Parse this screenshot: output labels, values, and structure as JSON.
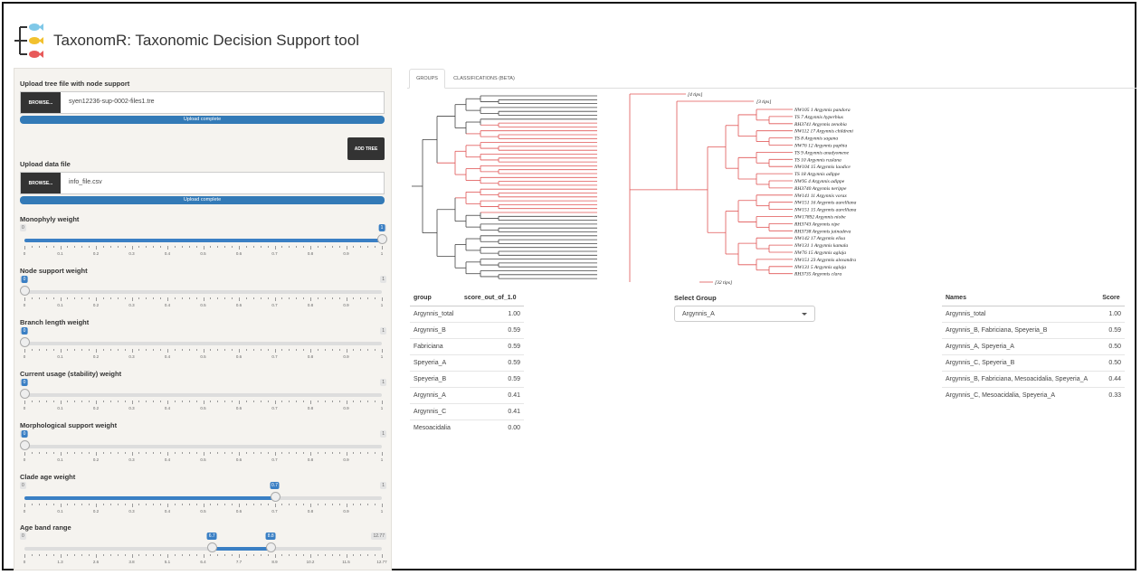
{
  "app": {
    "title": "TaxonomR: Taxonomic Decision Support tool"
  },
  "sidebar": {
    "tree_upload": {
      "label": "Upload tree file with node support",
      "browse_label": "BROWSE...",
      "filename": "syen12236-sup-0002-files1.tre",
      "status": "Upload complete"
    },
    "add_tree_label": "ADD TREE",
    "data_upload": {
      "label": "Upload data file",
      "browse_label": "BROWSE...",
      "filename": "info_file.csv",
      "status": "Upload complete"
    },
    "sliders": [
      {
        "label": "Monophyly weight",
        "value": 1,
        "value_label": "1",
        "min_label": "0",
        "max_label": "1",
        "ticks": [
          "0",
          "0.1",
          "0.2",
          "0.3",
          "0.4",
          "0.5",
          "0.6",
          "0.7",
          "0.8",
          "0.9",
          "1"
        ]
      },
      {
        "label": "Node support weight",
        "value": 0,
        "value_label": "0",
        "min_label": "0",
        "max_label": "1",
        "ticks": [
          "0",
          "0.1",
          "0.2",
          "0.3",
          "0.4",
          "0.5",
          "0.6",
          "0.7",
          "0.8",
          "0.9",
          "1"
        ]
      },
      {
        "label": "Branch length weight",
        "value": 0,
        "value_label": "0",
        "min_label": "0",
        "max_label": "1",
        "ticks": [
          "0",
          "0.1",
          "0.2",
          "0.3",
          "0.4",
          "0.5",
          "0.6",
          "0.7",
          "0.8",
          "0.9",
          "1"
        ]
      },
      {
        "label": "Current usage (stability) weight",
        "value": 0,
        "value_label": "0",
        "min_label": "0",
        "max_label": "1",
        "ticks": [
          "0",
          "0.1",
          "0.2",
          "0.3",
          "0.4",
          "0.5",
          "0.6",
          "0.7",
          "0.8",
          "0.9",
          "1"
        ]
      },
      {
        "label": "Morphological support weight",
        "value": 0,
        "value_label": "0",
        "min_label": "0",
        "max_label": "1",
        "ticks": [
          "0",
          "0.1",
          "0.2",
          "0.3",
          "0.4",
          "0.5",
          "0.6",
          "0.7",
          "0.8",
          "0.9",
          "1"
        ]
      },
      {
        "label": "Clade age weight",
        "value": 0.7,
        "value_label": "0.7",
        "min_label": "0",
        "max_label": "1",
        "ticks": [
          "0",
          "0.1",
          "0.2",
          "0.3",
          "0.4",
          "0.5",
          "0.6",
          "0.7",
          "0.8",
          "0.9",
          "1"
        ]
      }
    ],
    "age_band": {
      "label": "Age band range",
      "low": 6.7,
      "high": 8.8,
      "low_label": "6.7",
      "high_label": "8.8",
      "min": 0,
      "max": 12.77,
      "min_label": "0",
      "max_label": "12.77",
      "ticks": [
        "0",
        "1.3",
        "2.6",
        "3.8",
        "5.1",
        "6.4",
        "7.7",
        "8.9",
        "10.2",
        "11.5",
        "12.77"
      ]
    }
  },
  "tabs": [
    {
      "label": "GROUPS",
      "active": true
    },
    {
      "label": "CLASSIFICATIONS (BETA)",
      "active": false
    }
  ],
  "tree_collapsed_labels": [
    "[4 tips]",
    "[3 tips]",
    "[32 tips]"
  ],
  "tips": [
    "NW105 1 Argynnis pandora",
    "TS 7 Argynnis hyperbius",
    "RH3741 Argynnis zenobia",
    "NW112 17 Argynnis childreni",
    "TS 8 Argynnis sagana",
    "NW76 12 Argynnis paphia",
    "TS 9 Argynnis anadyomene",
    "TS 10 Argynnis ruslana",
    "NW104 15 Argynnis laodice",
    "TS 18 Argynnis adippe",
    "NW95 4 Argynnis adippe",
    "RH3740 Argynnis nerippe",
    "NW141 11 Argynnis vorax",
    "NW151 16 Argynnis aurelliana",
    "NW151 15 Argynnis aurelliana",
    "NW17892 Argynnis niobe",
    "RH3743 Argynnis xipe",
    "RH3738 Argynnis jainadeva",
    "NW142 17 Argynnis elisa",
    "NW131 1 Argynnis kamala",
    "NW76 15 Argynnis aglaja",
    "NW151 23 Argynnis alexandra",
    "NW131 5 Argynnis aglaja",
    "RH3735 Argynnis clara"
  ],
  "group_table": {
    "headers": [
      "group",
      "score_out_of_1.0"
    ],
    "rows": [
      [
        "Argynnis_total",
        "1.00"
      ],
      [
        "Argynnis_B",
        "0.59"
      ],
      [
        "Fabriciana",
        "0.59"
      ],
      [
        "Speyeria_A",
        "0.59"
      ],
      [
        "Speyeria_B",
        "0.59"
      ],
      [
        "Argynnis_A",
        "0.41"
      ],
      [
        "Argynnis_C",
        "0.41"
      ],
      [
        "Mesoacidalia",
        "0.00"
      ]
    ]
  },
  "select_group": {
    "label": "Select Group",
    "value": "Argynnis_A"
  },
  "score_table": {
    "headers": [
      "Names",
      "Score"
    ],
    "rows": [
      [
        "Argynnis_total",
        "1.00"
      ],
      [
        "Argynnis_B, Fabriciana, Speyeria_B",
        "0.59"
      ],
      [
        "Argynnis_A, Speyeria_A",
        "0.50"
      ],
      [
        "Argynnis_C, Speyeria_B",
        "0.50"
      ],
      [
        "Argynnis_B, Fabriciana, Mesoacidalia, Speyeria_A",
        "0.44"
      ],
      [
        "Argynnis_C, Mesoacidalia, Speyeria_A",
        "0.33"
      ]
    ]
  },
  "colors": {
    "highlight_branch": "#e05555",
    "default_branch": "#444444",
    "slider_fill": "#3a7fc4",
    "dark_button": "#333333"
  }
}
